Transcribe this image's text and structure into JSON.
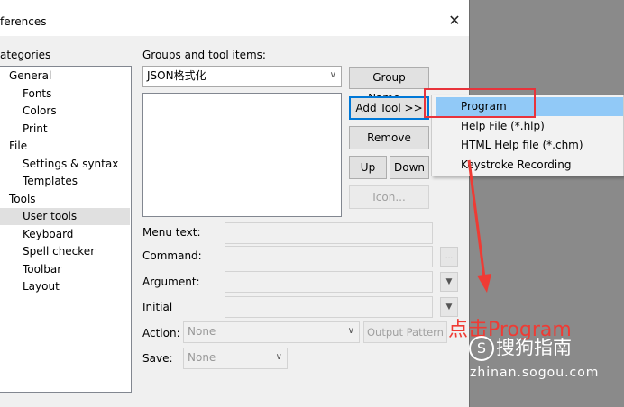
{
  "window": {
    "title": "ferences",
    "close_glyph": "✕"
  },
  "categories": {
    "label": "ategories",
    "items": [
      {
        "label": "General",
        "level": 1
      },
      {
        "label": "Fonts",
        "level": 2
      },
      {
        "label": "Colors",
        "level": 2
      },
      {
        "label": "Print",
        "level": 2
      },
      {
        "label": "File",
        "level": 1
      },
      {
        "label": "Settings & syntax",
        "level": 2
      },
      {
        "label": "Templates",
        "level": 2
      },
      {
        "label": "Tools",
        "level": 1
      },
      {
        "label": "User tools",
        "level": 2,
        "selected": true
      },
      {
        "label": "Keyboard",
        "level": 2
      },
      {
        "label": "Spell checker",
        "level": 2
      },
      {
        "label": "Toolbar",
        "level": 2
      },
      {
        "label": "Layout",
        "level": 2
      }
    ]
  },
  "groups": {
    "label": "Groups and tool items:",
    "selected": "JSON格式化",
    "group_name_button": "Group Name...",
    "add_tool_button": "Add Tool >>",
    "remove_button": "Remove",
    "up_button": "Up",
    "down_button": "Down",
    "icon_button": "Icon..."
  },
  "form": {
    "menu_text_label": "Menu text:",
    "command_label": "Command:",
    "argument_label": "Argument:",
    "initial_label": "Initial",
    "action_label": "Action:",
    "action_value": "None",
    "output_pattern_button": "Output Pattern",
    "save_label": "Save:",
    "save_value": "None",
    "browse_glyph": "...",
    "dropdown_glyph": "▼"
  },
  "popup_menu": {
    "items": [
      "Program",
      "Help File (*.hlp)",
      "HTML Help file (*.chm)",
      "Keystroke Recording"
    ],
    "highlighted_index": 0
  },
  "annotation": {
    "caption": "点击Program",
    "color": "#ef3b34"
  },
  "watermark": {
    "brand": "搜狗指南",
    "logo_glyph": "S",
    "url": "zhinan.sogou.com"
  }
}
